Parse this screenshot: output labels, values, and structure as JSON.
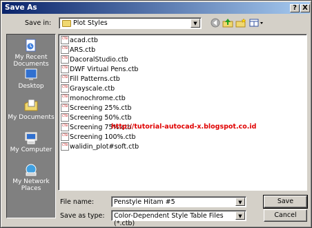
{
  "window": {
    "title": "Save As"
  },
  "titlebar_buttons": {
    "help": "?",
    "close": "X"
  },
  "toolbar": {
    "save_in_label": "Save in:",
    "save_in_value": "Plot Styles",
    "icons": [
      "back-icon",
      "up-folder-icon",
      "new-folder-icon",
      "views-menu-icon"
    ]
  },
  "places": [
    {
      "label_line1": "My Recent",
      "label_line2": "Documents",
      "icon": "recent-documents-icon"
    },
    {
      "label_line1": "Desktop",
      "label_line2": "",
      "icon": "desktop-icon"
    },
    {
      "label_line1": "My Documents",
      "label_line2": "",
      "icon": "my-documents-icon"
    },
    {
      "label_line1": "My Computer",
      "label_line2": "",
      "icon": "my-computer-icon"
    },
    {
      "label_line1": "My Network",
      "label_line2": "Places",
      "icon": "network-places-icon"
    }
  ],
  "files": [
    "acad.ctb",
    "ARS.ctb",
    "DacoralStudio.ctb",
    "DWF Virtual Pens.ctb",
    "Fill Patterns.ctb",
    "Grayscale.ctb",
    "monochrome.ctb",
    "Screening 25%.ctb",
    "Screening 50%.ctb",
    "Screening 75%.ctb",
    "Screening 100%.ctb",
    "walidin_plot#soft.ctb"
  ],
  "file_icon_text": "CTB",
  "watermark": "http://tutorial-autocad-x.blogspot.co.id",
  "form": {
    "file_name_label": "File name:",
    "file_name_value": "Penstyle Hitam #5",
    "save_type_label": "Save as type:",
    "save_type_value": "Color-Dependent Style Table Files (*.ctb)"
  },
  "buttons": {
    "save": "Save",
    "cancel": "Cancel"
  },
  "colors": {
    "title_start": "#0a246a",
    "title_end": "#a6caf0",
    "watermark": "#e00000"
  }
}
